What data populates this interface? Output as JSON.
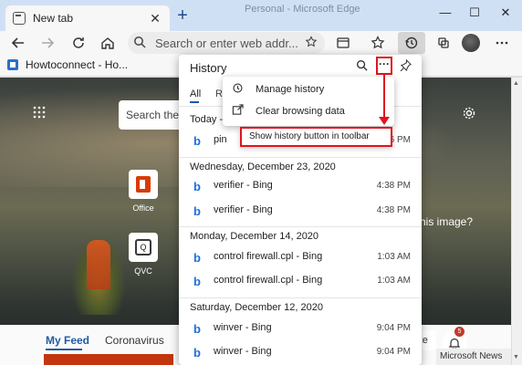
{
  "window": {
    "title": "Personal - Microsoft Edge",
    "tab_title": "New tab",
    "new_tab_symbol": "+",
    "tab_close_symbol": "✕",
    "minimize_symbol": "—",
    "maximize_symbol": "☐",
    "close_symbol": "✕"
  },
  "toolbar": {
    "address_placeholder": "Search or enter web addr..."
  },
  "favorites": {
    "items": [
      {
        "label": "Howtoconnect - Ho..."
      }
    ]
  },
  "newtab_page": {
    "search_placeholder": "Search the",
    "tiles": [
      {
        "label": "Office"
      },
      {
        "label": "QVC"
      }
    ],
    "image_caption": "his image?",
    "feed_tabs": [
      "My Feed",
      "Coronavirus"
    ],
    "customize_label": "ze",
    "notification_count": "5",
    "microsoft_news_label": "Microsoft News"
  },
  "history_panel": {
    "title": "History",
    "tabs": [
      "All",
      "Re"
    ],
    "groups": [
      {
        "date": "Today - W",
        "items": [
          {
            "title": "pin",
            "time": "06 PM"
          }
        ]
      },
      {
        "date": "Wednesday, December 23, 2020",
        "items": [
          {
            "title": "verifier - Bing",
            "time": "4:38 PM"
          },
          {
            "title": "verifier - Bing",
            "time": "4:38 PM"
          }
        ]
      },
      {
        "date": "Monday, December 14, 2020",
        "items": [
          {
            "title": "control firewall.cpl - Bing",
            "time": "1:03 AM"
          },
          {
            "title": "control firewall.cpl - Bing",
            "time": "1:03 AM"
          }
        ]
      },
      {
        "date": "Saturday, December 12, 2020",
        "items": [
          {
            "title": "winver - Bing",
            "time": "9:04 PM"
          },
          {
            "title": "winver - Bing",
            "time": "9:04 PM"
          }
        ]
      }
    ]
  },
  "context_menu": {
    "items": [
      {
        "label": "Manage history",
        "icon": "history-icon"
      },
      {
        "label": "Clear browsing data",
        "icon": "external-link-icon"
      },
      {
        "label": "Show history button in toolbar",
        "icon": ""
      }
    ]
  },
  "colors": {
    "highlight_red": "#e0141e",
    "accent_blue": "#1f5aa6",
    "bing_blue": "#1e6fd9"
  }
}
